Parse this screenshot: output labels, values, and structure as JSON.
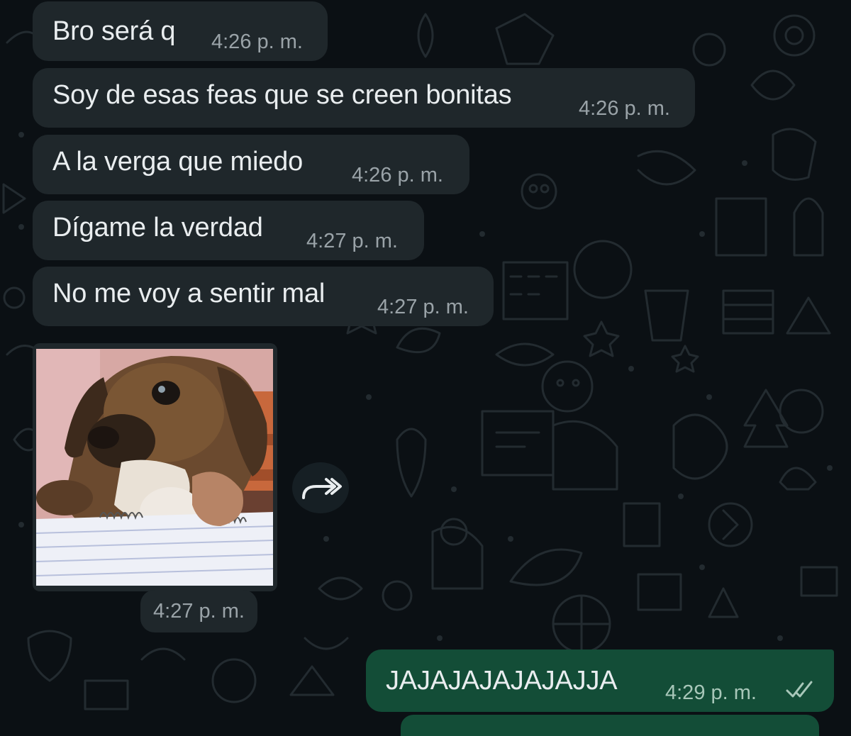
{
  "colors": {
    "background": "#0b1014",
    "incoming_bubble": "#1f272b",
    "outgoing_bubble": "#134d37",
    "text": "#e9edef",
    "meta_text": "#9aa3a8",
    "read_ticks": "#a8c7b9"
  },
  "messages": [
    {
      "direction": "incoming",
      "text": "Bro será q",
      "time": "4:26 p. m."
    },
    {
      "direction": "incoming",
      "text": "Soy de esas feas que se creen bonitas",
      "time": "4:26 p. m."
    },
    {
      "direction": "incoming",
      "text": "A la verga que miedo",
      "time": "4:26 p. m."
    },
    {
      "direction": "incoming",
      "text": "Dígame la verdad",
      "time": "4:27 p. m."
    },
    {
      "direction": "incoming",
      "text": "No me voy a sentir mal",
      "time": "4:27 p. m."
    }
  ],
  "media_message": {
    "direction": "incoming",
    "kind": "photo",
    "time": "4:27 p. m.",
    "forward_icon": "forward-icon"
  },
  "outgoing_message": {
    "text": "JAJAJAJAJAJAJJA",
    "time": "4:29 p. m.",
    "status_icon": "double-check-icon"
  }
}
